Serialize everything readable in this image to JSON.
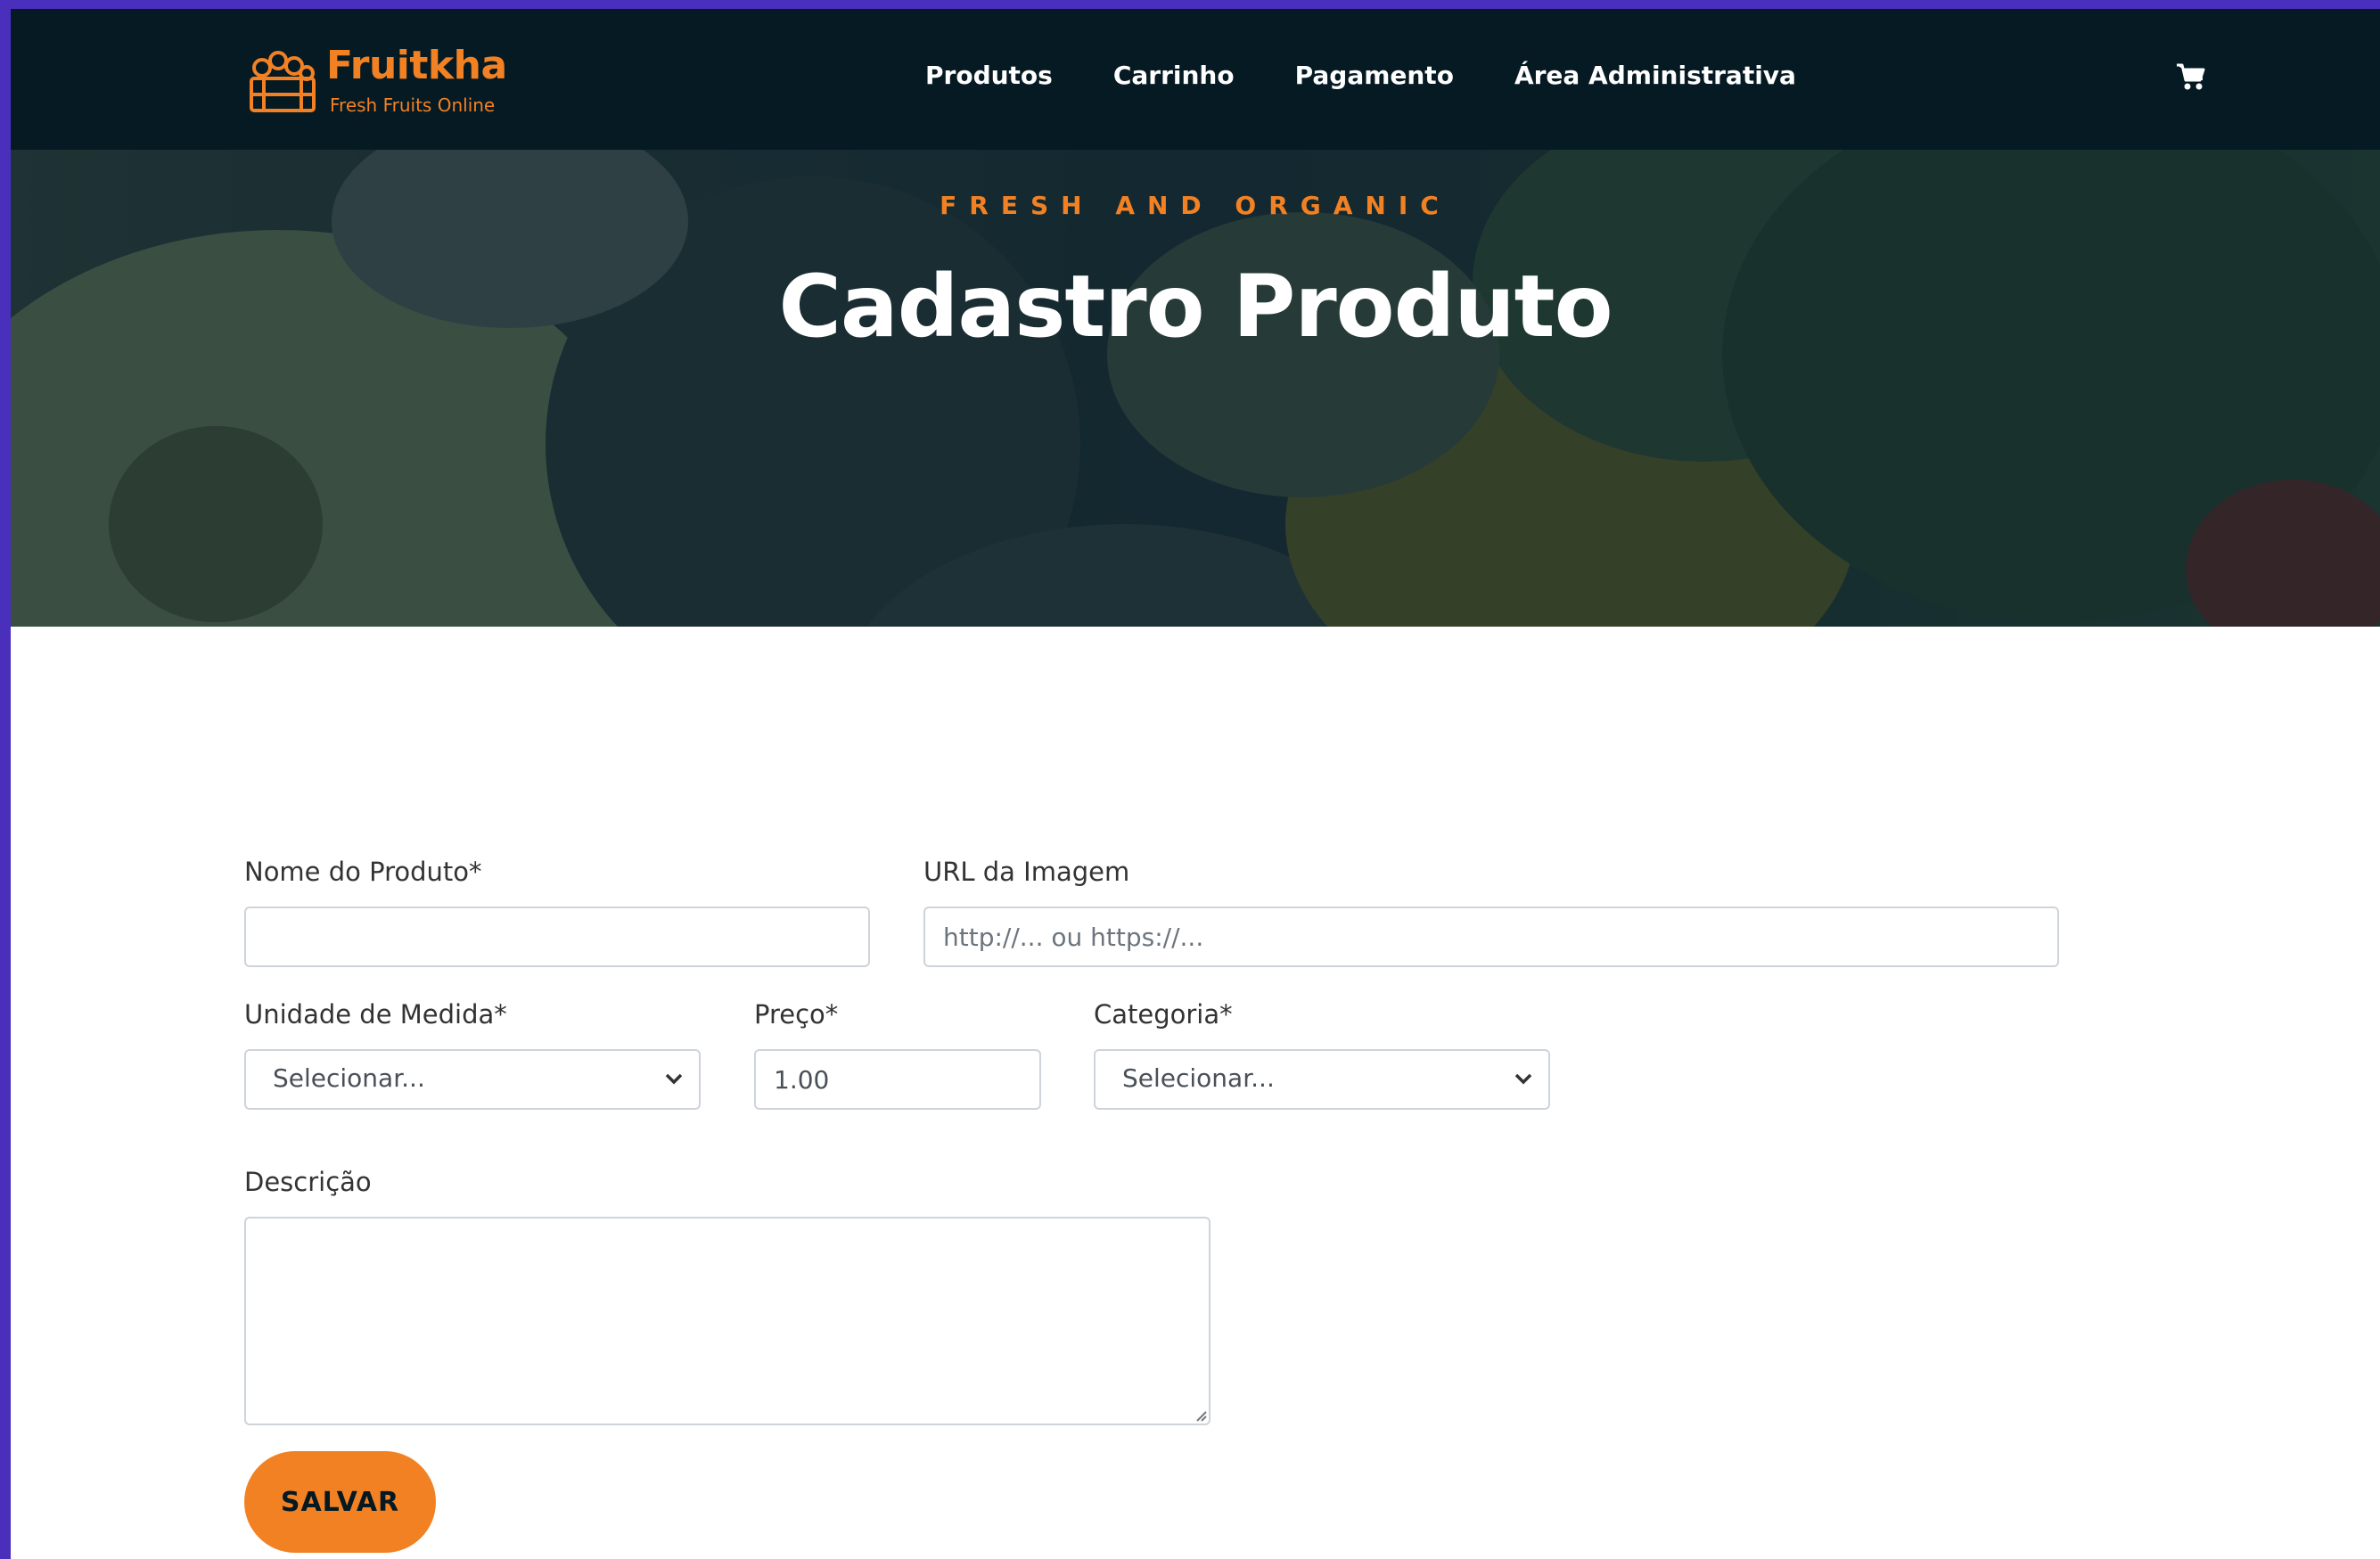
{
  "brand": {
    "name": "Fruitkha",
    "tagline": "Fresh Fruits Online",
    "icon": "fruit-crate-icon",
    "accent_color": "#f28123"
  },
  "nav": {
    "items": [
      {
        "label": "Produtos"
      },
      {
        "label": "Carrinho"
      },
      {
        "label": "Pagamento"
      },
      {
        "label": "Área Administrativa"
      }
    ],
    "cart_icon": "shopping-cart-icon"
  },
  "hero": {
    "subtitle": "FRESH AND ORGANIC",
    "title": "Cadastro Produto"
  },
  "form": {
    "product_name": {
      "label": "Nome do Produto*",
      "value": ""
    },
    "image_url": {
      "label": "URL da Imagem",
      "placeholder": "http://... ou https://..."
    },
    "unit": {
      "label": "Unidade de Medida*",
      "selected": "Selecionar..."
    },
    "price": {
      "label": "Preço*",
      "value": "1.00"
    },
    "category": {
      "label": "Categoria*",
      "selected": "Selecionar..."
    },
    "description": {
      "label": "Descrição",
      "value": ""
    },
    "save_label": "SALVAR"
  }
}
